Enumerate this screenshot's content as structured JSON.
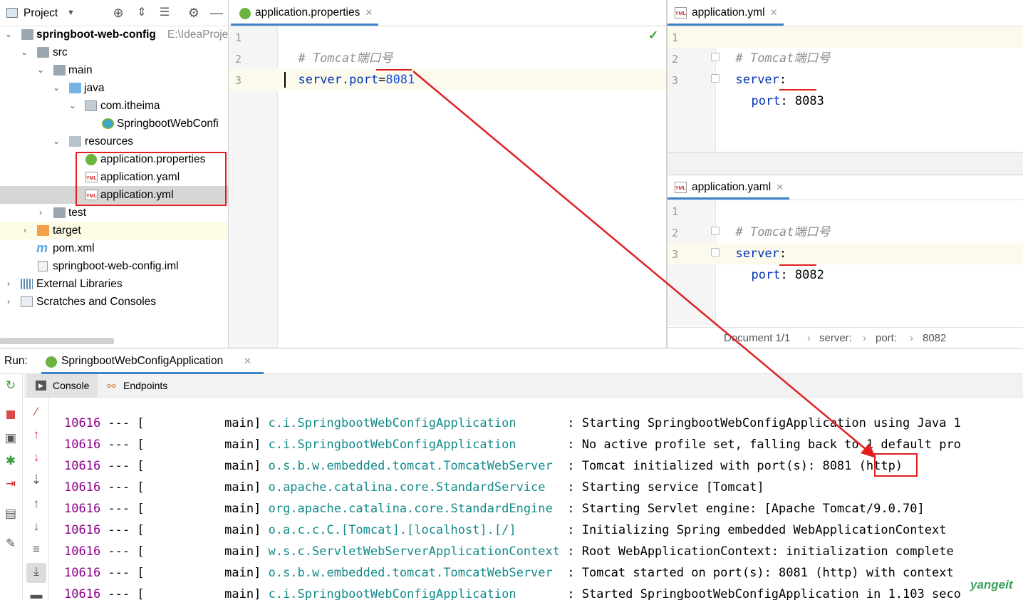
{
  "project": {
    "header_label": "Project",
    "tree": [
      {
        "label": "springboot-web-config",
        "path": "E:\\IdeaProje",
        "bold": true
      },
      {
        "label": "src"
      },
      {
        "label": "main"
      },
      {
        "label": "java"
      },
      {
        "label": "com.itheima"
      },
      {
        "label": "SpringbootWebConfi"
      },
      {
        "label": "resources"
      },
      {
        "label": "application.properties"
      },
      {
        "label": "application.yaml"
      },
      {
        "label": "application.yml"
      },
      {
        "label": "test"
      },
      {
        "label": "target"
      },
      {
        "label": "pom.xml"
      },
      {
        "label": "springboot-web-config.iml"
      },
      {
        "label": "External Libraries"
      },
      {
        "label": "Scratches and Consoles"
      }
    ]
  },
  "editor_properties": {
    "tab_label": "application.properties",
    "lines": {
      "n1": "1",
      "n2": "2",
      "n3": "3",
      "comment": "# Tomcat端口号",
      "key": "server.port",
      "eq": "=",
      "value": "8081"
    }
  },
  "editor_yml": {
    "tab_label": "application.yml",
    "lines": {
      "n1": "1",
      "n2": "2",
      "n3": "3",
      "comment": "# Tomcat端口号",
      "server": "server",
      "port_key": "port",
      "port_value": "8083"
    }
  },
  "editor_yaml": {
    "tab_label": "application.yaml",
    "lines": {
      "n1": "1",
      "n2": "2",
      "n3": "3",
      "comment": "# Tomcat端口号",
      "server": "server",
      "port_key": "port",
      "port_value": "8082"
    },
    "breadcrumb": {
      "doc": "Document 1/1",
      "b1": "server:",
      "b2": "port:",
      "b3": "8082"
    }
  },
  "run": {
    "label": "Run:",
    "config_tab": "SpringbootWebConfigApplication",
    "console_tab": "Console",
    "endpoints_tab": "Endpoints",
    "log": [
      {
        "pid": "10616",
        "thread": " --- [           main] ",
        "logger": "c.i.SpringbootWebConfigApplication      ",
        "msg": " : Starting SpringbootWebConfigApplication using Java 1"
      },
      {
        "pid": "10616",
        "thread": " --- [           main] ",
        "logger": "c.i.SpringbootWebConfigApplication      ",
        "msg": " : No active profile set, falling back to 1 default pro"
      },
      {
        "pid": "10616",
        "thread": " --- [           main] ",
        "logger": "o.s.b.w.embedded.tomcat.TomcatWebServer ",
        "msg": " : Tomcat initialized with port(s): 8081 (http)"
      },
      {
        "pid": "10616",
        "thread": " --- [           main] ",
        "logger": "o.apache.catalina.core.StandardService  ",
        "msg": " : Starting service [Tomcat]"
      },
      {
        "pid": "10616",
        "thread": " --- [           main] ",
        "logger": "org.apache.catalina.core.StandardEngine ",
        "msg": " : Starting Servlet engine: [Apache Tomcat/9.0.70]"
      },
      {
        "pid": "10616",
        "thread": " --- [           main] ",
        "logger": "o.a.c.c.C.[Tomcat].[localhost].[/]      ",
        "msg": " : Initializing Spring embedded WebApplicationContext"
      },
      {
        "pid": "10616",
        "thread": " --- [           main] ",
        "logger": "w.s.c.ServletWebServerApplicationContext",
        "msg": " : Root WebApplicationContext: initialization complete"
      },
      {
        "pid": "10616",
        "thread": " --- [           main] ",
        "logger": "o.s.b.w.embedded.tomcat.TomcatWebServer ",
        "msg": " : Tomcat started on port(s): 8081 (http) with context"
      },
      {
        "pid": "10616",
        "thread": " --- [           main] ",
        "logger": "c.i.SpringbootWebConfigApplication      ",
        "msg": " : Started SpringbootWebConfigApplication in 1.103 seco"
      }
    ]
  },
  "watermark": "yangeit",
  "colors": {
    "annotation_red": "#e02020",
    "accent_blue": "#4083c9"
  }
}
